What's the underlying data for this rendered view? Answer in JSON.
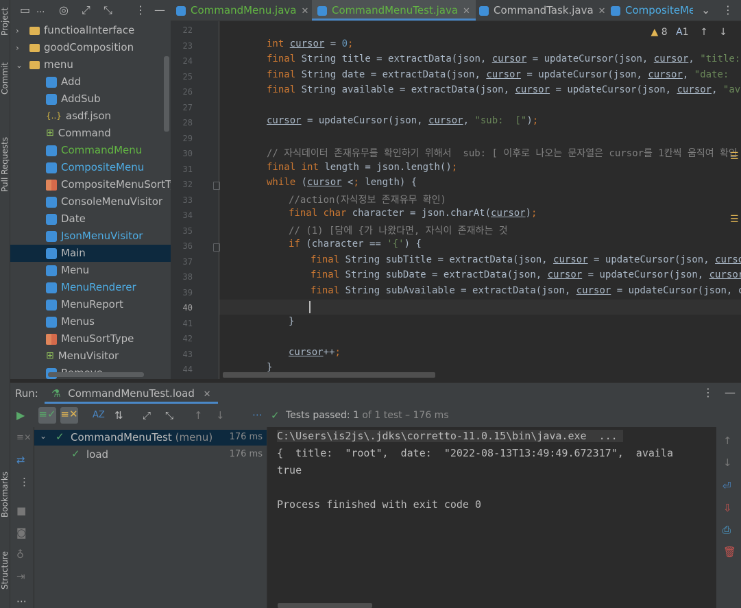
{
  "left_strip": {
    "tabs": [
      "Project",
      "Commit",
      "Pull Requests",
      "Bookmarks",
      "Structure"
    ]
  },
  "project": {
    "toolbar_ellipsis": "...",
    "tree": [
      {
        "label": "functioalInterface",
        "type": "folder",
        "depth": 0
      },
      {
        "label": "goodComposition",
        "type": "folder",
        "depth": 0
      },
      {
        "label": "menu",
        "type": "folder-open",
        "depth": 0
      },
      {
        "label": "Add",
        "type": "class",
        "color": "#bbbbbb"
      },
      {
        "label": "AddSub",
        "type": "class",
        "color": "#bbbbbb"
      },
      {
        "label": "asdf.json",
        "type": "json",
        "color": "#bbbbbb"
      },
      {
        "label": "Command",
        "type": "interface",
        "color": "#bbbbbb"
      },
      {
        "label": "CommandMenu",
        "type": "class",
        "color": "#62b543"
      },
      {
        "label": "CompositeMenu",
        "type": "class",
        "color": "#4eade5"
      },
      {
        "label": "CompositeMenuSortType",
        "type": "enum",
        "color": "#bbbbbb"
      },
      {
        "label": "ConsoleMenuVisitor",
        "type": "class",
        "color": "#bbbbbb"
      },
      {
        "label": "Date",
        "type": "class",
        "color": "#bbbbbb"
      },
      {
        "label": "JsonMenuVisitor",
        "type": "class",
        "color": "#4eade5"
      },
      {
        "label": "Main",
        "type": "class",
        "color": "#bbbbbb"
      },
      {
        "label": "Menu",
        "type": "class",
        "color": "#bbbbbb"
      },
      {
        "label": "MenuRenderer",
        "type": "class",
        "color": "#4eade5"
      },
      {
        "label": "MenuReport",
        "type": "class",
        "color": "#bbbbbb"
      },
      {
        "label": "Menus",
        "type": "class",
        "color": "#bbbbbb"
      },
      {
        "label": "MenuSortType",
        "type": "enum",
        "color": "#bbbbbb"
      },
      {
        "label": "MenuVisitor",
        "type": "interface",
        "color": "#bbbbbb"
      },
      {
        "label": "Remove",
        "type": "class",
        "color": "#bbbbbb"
      }
    ]
  },
  "tabs": [
    {
      "label": "CommandMenu.java",
      "color": "#62b543",
      "active": false
    },
    {
      "label": "CommandMenuTest.java",
      "color": "#62b543",
      "active": true
    },
    {
      "label": "CommandTask.java",
      "color": "#bbbbbb",
      "active": false
    },
    {
      "label": "CompositeMe",
      "color": "#4eade5",
      "active": false
    }
  ],
  "editor": {
    "warnings": "8",
    "typos": "1",
    "line_numbers": [
      "22",
      "23",
      "24",
      "25",
      "26",
      "27",
      "28",
      "29",
      "30",
      "31",
      "32",
      "33",
      "34",
      "35",
      "36",
      "37",
      "38",
      "39",
      "40",
      "41",
      "42",
      "43",
      "44"
    ],
    "current_line": "40",
    "code": {
      "l23": "int cursor = 0;",
      "l24": "final String title = extractData(json, cursor = updateCursor(json, cursor, \"title:  \\\"\"",
      "l25": "final String date = extractData(json, cursor = updateCursor(json, cursor, \"date:  \\\"\"));",
      "l26": "final String available = extractData(json, cursor = updateCursor(json, cursor, \"availa",
      "l28": "cursor = updateCursor(json, cursor, \"sub:  [\");",
      "l30": "// 자식데이터 존재유무를 확인하기 위해서  sub: [ 이후로 나오는 문자열은 cursor를 1칸씩 움직여 확인",
      "l31": "final int length = json.length();",
      "l32": "while (cursor < length) {",
      "l33": "//action(자식정보 존재유무 확인)",
      "l34": "final char character = json.charAt(cursor);",
      "l35": "// (1) [담에 {가 나왔다면, 자식이 존재하는 것",
      "l36": "if (character == '{') {",
      "l37": "final String subTitle = extractData(json, cursor = updateCursor(json, cursor, \"",
      "l38": "final String subDate = extractData(json, cursor = updateCursor(json, cursor, \"d",
      "l39": "final String subAvailable = extractData(json, cursor = updateCursor(json, curso",
      "l41": "}",
      "l43": "cursor++;",
      "l44": "}"
    }
  },
  "run": {
    "label": "Run:",
    "config": "CommandMenuTest.load",
    "status_prefix": "Tests passed:",
    "status_count": "1",
    "status_suffix": "of 1 test – 176 ms",
    "tests": [
      {
        "name": "CommandMenuTest",
        "pkg": "(menu)",
        "time": "176 ms"
      },
      {
        "name": "load",
        "pkg": "",
        "time": "176 ms"
      }
    ],
    "console": [
      "C:\\Users\\is2js\\.jdks\\corretto-11.0.15\\bin\\java.exe  ...",
      "{  title:  \"root\",  date:  \"2022-08-13T13:49:49.672317\",  availa",
      "true",
      "",
      "Process finished with exit code 0"
    ]
  }
}
